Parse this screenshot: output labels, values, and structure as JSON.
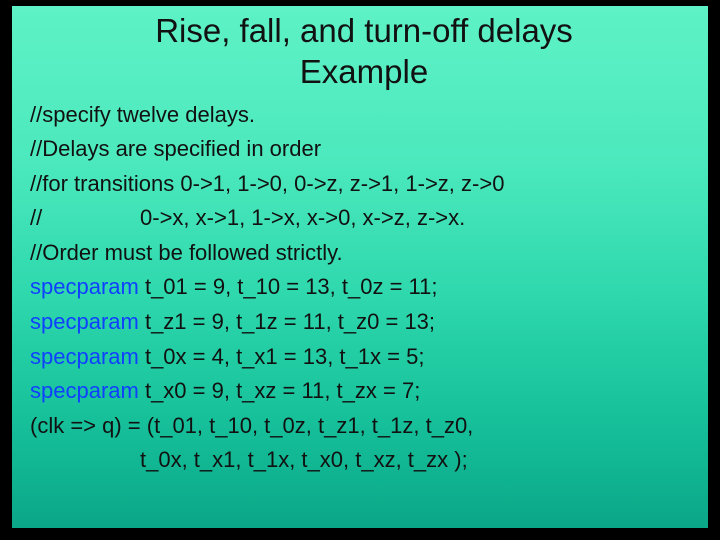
{
  "title_line1": "Rise, fall, and turn-off delays",
  "title_line2": "Example",
  "lines": {
    "c1": "//specify twelve delays.",
    "c2": "//Delays are specified in order",
    "c3": "//for transitions 0->1, 1->0, 0->z, z->1, 1->z, z->0",
    "c4": "//                0->x, x->1, 1->x, x->0, x->z, z->x.",
    "c5": "//Order must be followed strictly.",
    "kw": "specparam",
    "s1": " t_01 = 9, t_10 = 13, t_0z = 11;",
    "s2": " t_z1 = 9, t_1z = 11, t_z0 = 13;",
    "s3": " t_0x = 4, t_x1 = 13, t_1x = 5;",
    "s4": " t_x0 = 9, t_xz = 11, t_zx = 7;",
    "a1": "(clk => q) = (t_01, t_10, t_0z, t_z1, t_1z, t_z0,",
    "a2": "t_0x, t_x1, t_1x, t_x0, t_xz, t_zx );"
  }
}
